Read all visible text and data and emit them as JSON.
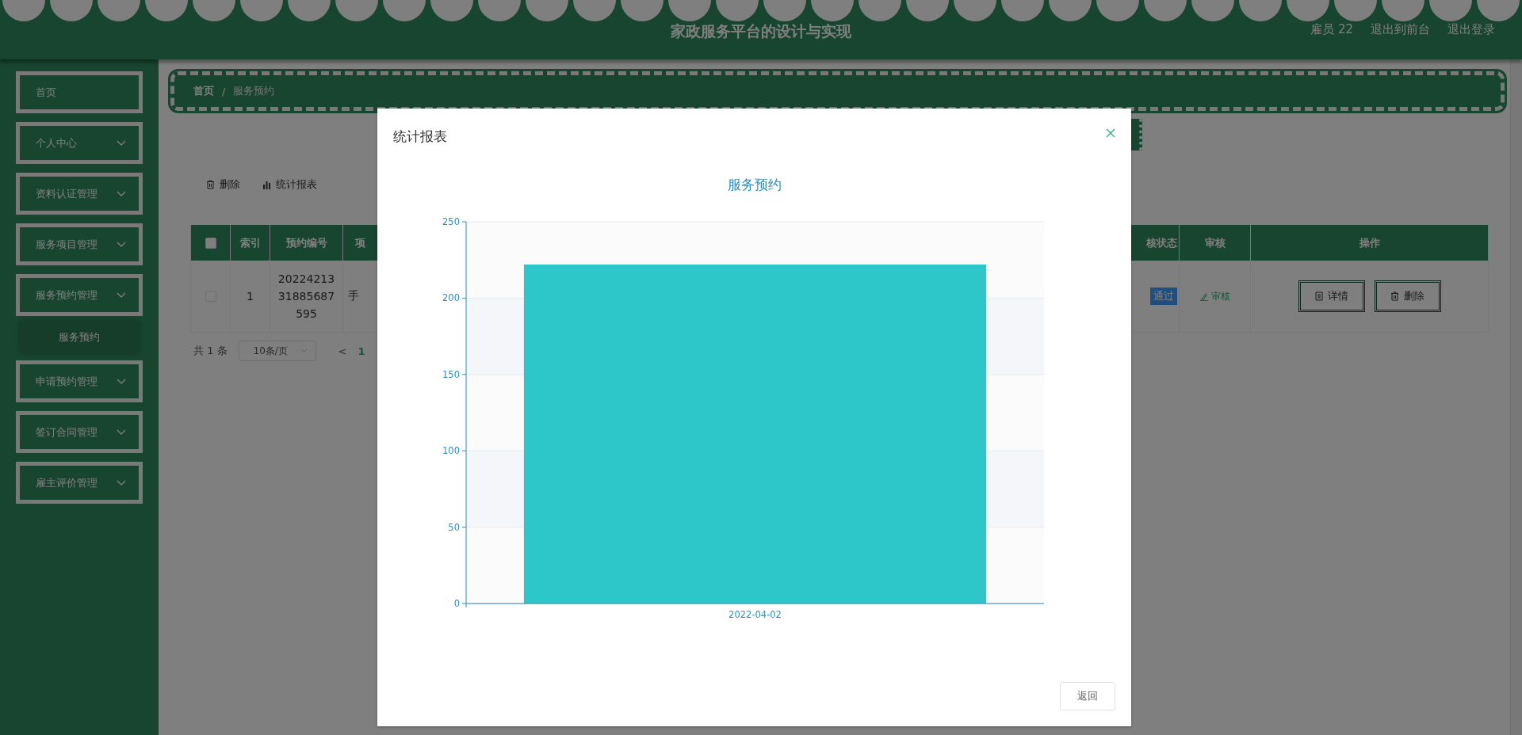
{
  "header": {
    "title": "家政服务平台的设计与实现",
    "user": "雇员 22",
    "links": [
      "退出到前台",
      "退出登录"
    ]
  },
  "sidebar": {
    "items": [
      {
        "label": "首页",
        "kind": "link"
      },
      {
        "label": "个人中心",
        "kind": "submenu"
      },
      {
        "label": "资料认证管理",
        "kind": "submenu"
      },
      {
        "label": "服务项目管理",
        "kind": "submenu"
      },
      {
        "label": "服务预约管理",
        "kind": "submenu",
        "children": [
          {
            "label": "服务预约"
          }
        ]
      },
      {
        "label": "申请预约管理",
        "kind": "submenu"
      },
      {
        "label": "签订合同管理",
        "kind": "submenu"
      },
      {
        "label": "雇主评价管理",
        "kind": "submenu"
      }
    ]
  },
  "breadcrumb": {
    "items": [
      "首页",
      "服务预约"
    ],
    "separator": "/"
  },
  "toolbar": [
    {
      "label": "删除",
      "kind": "delete"
    },
    {
      "label": "统计报表",
      "kind": "chart"
    }
  ],
  "table": {
    "select_all": {
      "checked": false
    },
    "columns": [
      "索引",
      "预约编号",
      "项",
      "核状态",
      "审核",
      "操作"
    ],
    "rows": [
      {
        "checked": false,
        "index": "1",
        "number": "2022421331885687595",
        "column_3": "手",
        "status": "通过",
        "review": "审核",
        "actions": [
          {
            "label": "详情",
            "kind": "detail"
          },
          {
            "label": "删除",
            "kind": "delete"
          }
        ]
      }
    ]
  },
  "pagination": {
    "total": "共 1 条",
    "page_size": "10条/页",
    "prev": "<",
    "pages": [
      {
        "label": "1",
        "selected": true
      }
    ]
  },
  "modal": {
    "title": "统计报表",
    "buttons": [
      "返回"
    ],
    "chart_data": {
      "type": "bar",
      "title": "服务预约",
      "categories": [
        "2022-04-02"
      ],
      "series": [
        {
          "color": "#2ec7c9",
          "values": [
            222
          ]
        }
      ],
      "grid": true,
      "ylim": [
        0,
        250
      ],
      "yticks": [
        0,
        50,
        100,
        150,
        200,
        250
      ]
    }
  }
}
